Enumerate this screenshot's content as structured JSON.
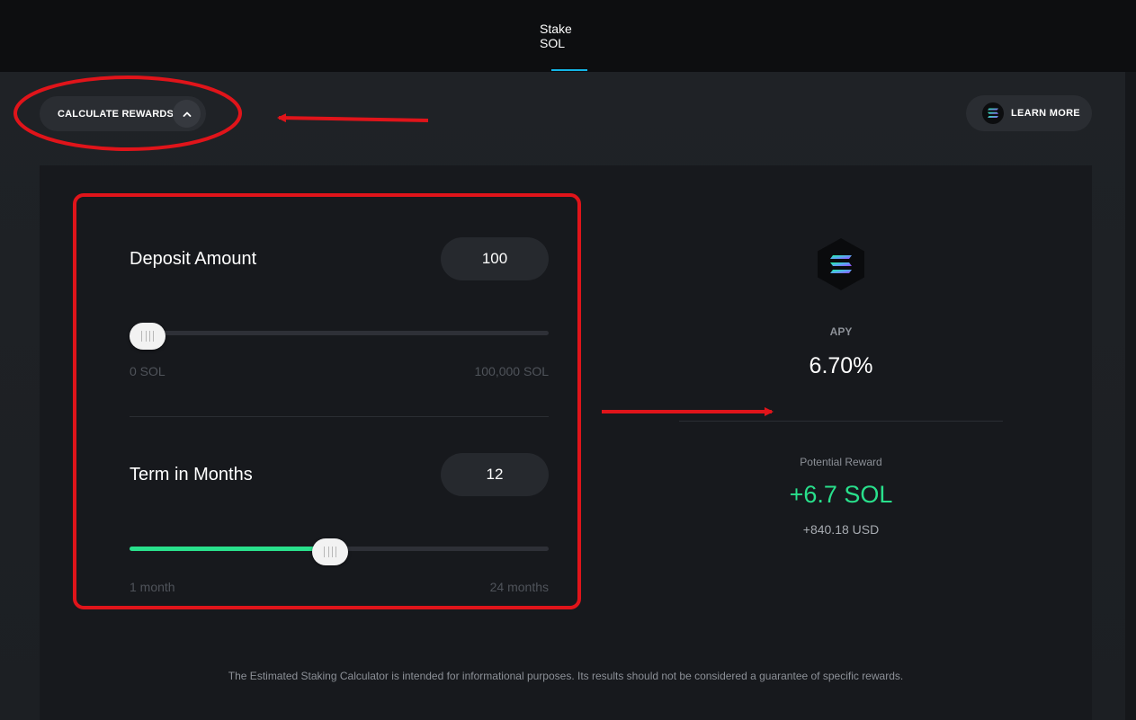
{
  "header": {
    "tab_label": "Stake SOL",
    "accent": "#14b5e6"
  },
  "toolbar": {
    "calculate_label": "CALCULATE REWARDS",
    "calculate_icon": "chevron-up-icon",
    "learn_label": "LEARN MORE",
    "learn_icon": "solana-logo-icon"
  },
  "calculator": {
    "deposit": {
      "label": "Deposit Amount",
      "value": "100",
      "min_label": "0 SOL",
      "max_label": "100,000 SOL",
      "level": 0.001
    },
    "term": {
      "label": "Term in Months",
      "value": "12",
      "min_label": "1 month",
      "max_label": "24 months",
      "level": 0.478
    }
  },
  "results": {
    "apy_label": "APY",
    "apy_value": "6.70%",
    "reward_label": "Potential Reward",
    "reward_sol": "+6.7 SOL",
    "reward_usd": "+840.18 USD",
    "reward_color": "#29e08c"
  },
  "disclaimer": "The Estimated Staking Calculator is intended for informational purposes. Its results should not be considered a guarantee of specific rewards."
}
